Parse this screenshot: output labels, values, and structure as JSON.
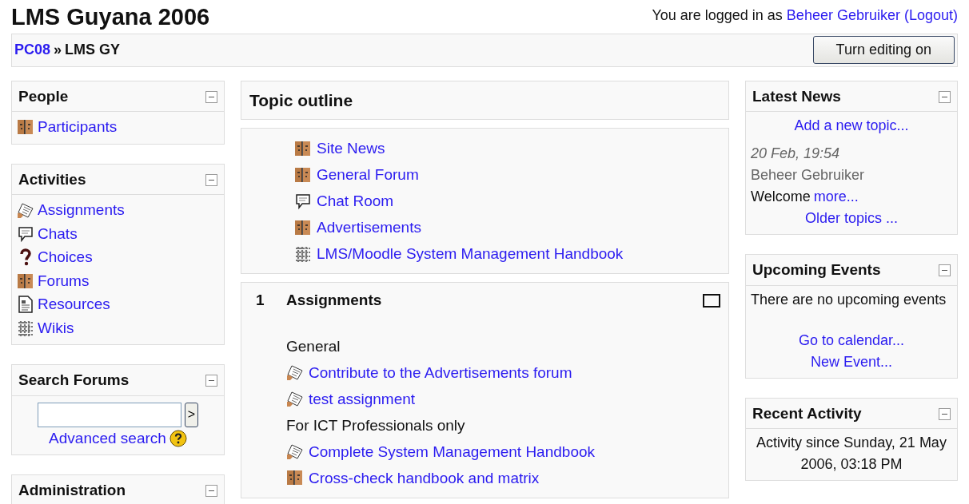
{
  "header": {
    "title": "LMS Guyana 2006",
    "login_prefix": "You are logged in as",
    "user": "Beheer Gebruiker",
    "logout": "(Logout)"
  },
  "breadcrumb": {
    "parent": "PC08",
    "separator": "»",
    "current": "LMS GY"
  },
  "edit_button": "Turn editing on",
  "left_blocks": [
    {
      "kind": "list",
      "title": "People",
      "items": [
        {
          "kind": "forum",
          "label": "Participants"
        }
      ]
    },
    {
      "kind": "list",
      "title": "Activities",
      "items": [
        {
          "kind": "assignment",
          "label": "Assignments"
        },
        {
          "kind": "chat",
          "label": "Chats"
        },
        {
          "kind": "choice",
          "label": "Choices"
        },
        {
          "kind": "forum",
          "label": "Forums"
        },
        {
          "kind": "resource",
          "label": "Resources"
        },
        {
          "kind": "wiki",
          "label": "Wikis"
        }
      ]
    },
    {
      "kind": "search",
      "title": "Search Forums",
      "button": ">",
      "link": "Advanced search"
    },
    {
      "kind": "list",
      "title": "Administration"
    }
  ],
  "topic_outline": {
    "title": "Topic outline",
    "sections": [
      {
        "items": [
          {
            "kind": "forum",
            "label": "Site News"
          },
          {
            "kind": "forum",
            "label": "General Forum"
          },
          {
            "kind": "chat",
            "label": "Chat Room"
          },
          {
            "kind": "forum",
            "label": "Advertisements"
          },
          {
            "kind": "wiki",
            "label": "LMS/Moodle System Management Handbook"
          }
        ]
      },
      {
        "number": "1",
        "title": "Assignments",
        "items": [
          {
            "kind": "label",
            "label": "General"
          },
          {
            "kind": "assignment",
            "label": "Contribute to the Advertisements forum"
          },
          {
            "kind": "assignment",
            "label": "test assignment"
          },
          {
            "kind": "label",
            "label": "For ICT Professionals only"
          },
          {
            "kind": "assignment",
            "label": "Complete System Management Handbook"
          },
          {
            "kind": "forum",
            "label": "Cross-check handbook and matrix"
          }
        ]
      }
    ]
  },
  "right_blocks": [
    {
      "kind": "news",
      "title": "Latest News",
      "add_link": "Add a new topic...",
      "date": "20 Feb, 19:54",
      "author": "Beheer Gebruiker",
      "text": "Welcome",
      "more": "more...",
      "older": "Older topics ..."
    },
    {
      "kind": "events",
      "title": "Upcoming Events",
      "text": "There are no upcoming events",
      "links": [
        "Go to calendar...",
        "New Event..."
      ]
    },
    {
      "kind": "activity",
      "title": "Recent Activity",
      "text": "Activity since Sunday, 21 May 2006, 03:18 PM"
    }
  ]
}
